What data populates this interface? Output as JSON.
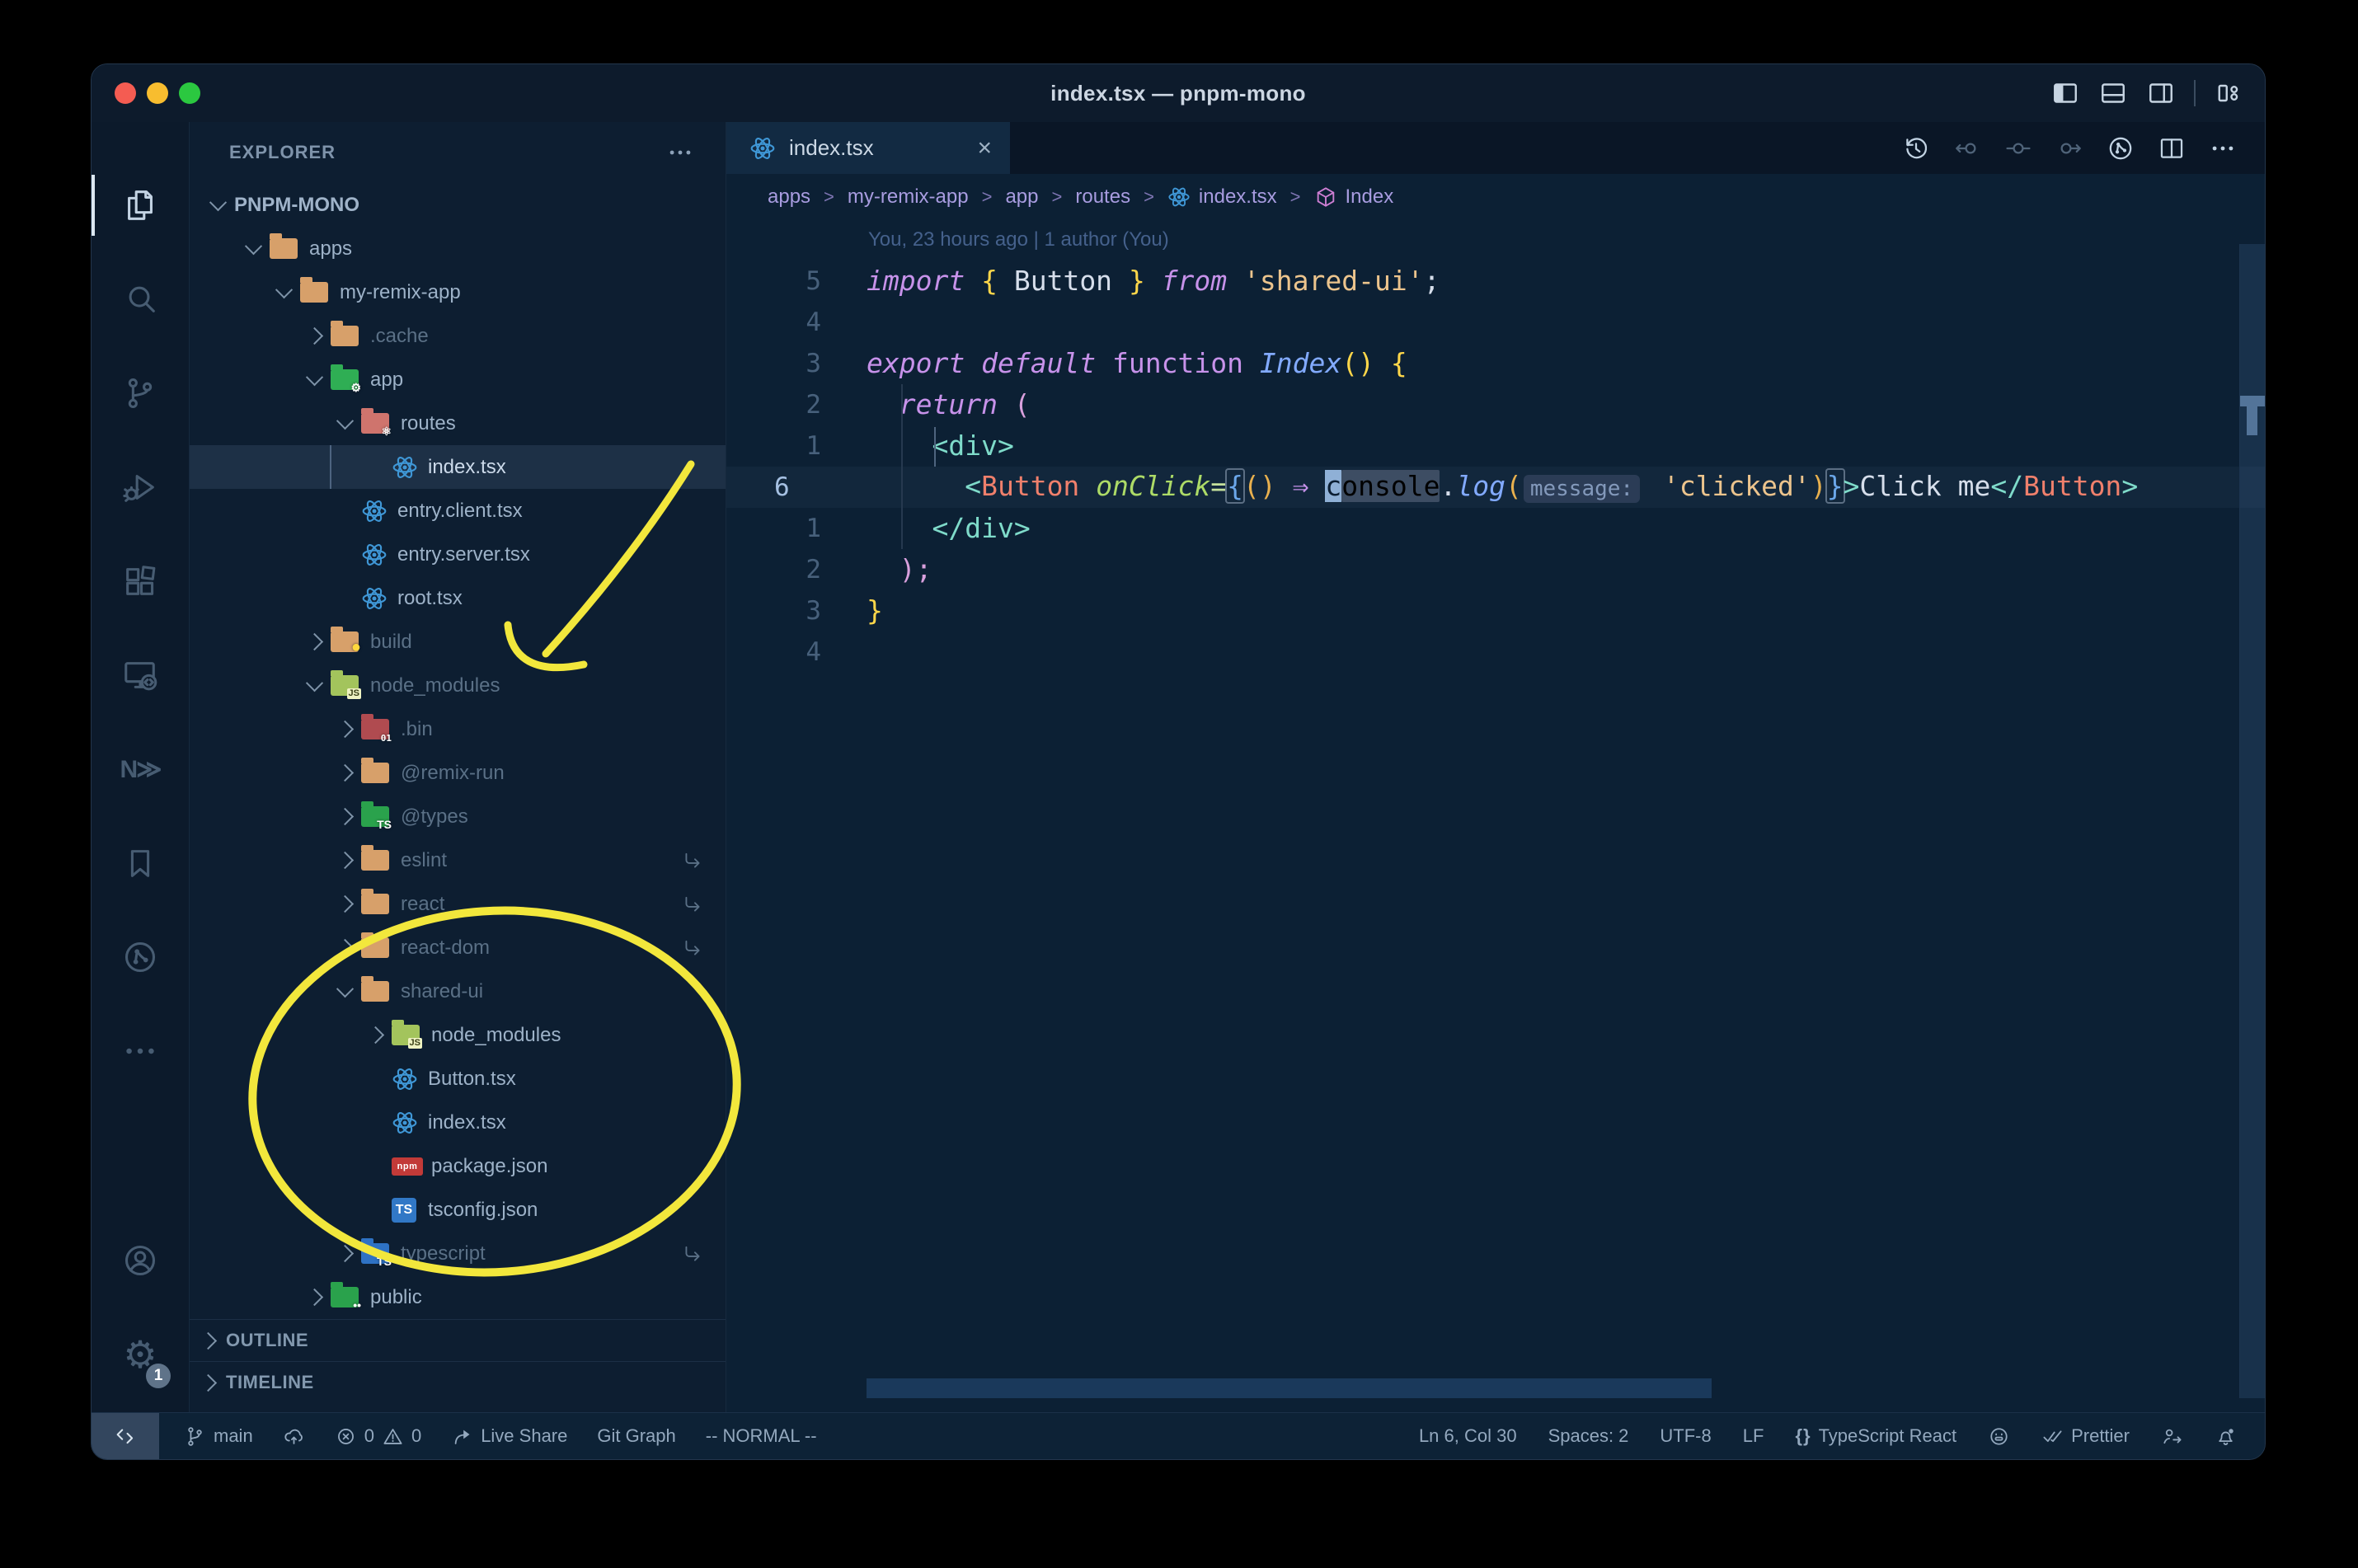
{
  "window": {
    "title": "index.tsx — pnpm-mono",
    "controls": [
      {
        "id": "toggle-primary-sidebar",
        "icon": "win-left"
      },
      {
        "id": "toggle-panel",
        "icon": "win-bottom"
      },
      {
        "id": "toggle-secondary-sidebar",
        "icon": "win-right"
      },
      {
        "id": "customize-layout",
        "icon": "layout"
      }
    ]
  },
  "activity_bar": {
    "items": [
      {
        "id": "explorer",
        "icon": "files",
        "active": true
      },
      {
        "id": "search",
        "icon": "search",
        "active": false
      },
      {
        "id": "source-control",
        "icon": "git",
        "active": false
      },
      {
        "id": "run-debug",
        "icon": "debug",
        "active": false
      },
      {
        "id": "extensions",
        "icon": "extensions",
        "active": false
      },
      {
        "id": "remote-explorer",
        "icon": "remote",
        "active": false
      },
      {
        "id": "nx-console",
        "icon": "nx",
        "text": "N≫",
        "active": false
      },
      {
        "id": "bookmarks",
        "icon": "bookmark",
        "active": false
      },
      {
        "id": "git-graph",
        "icon": "gitgraph",
        "active": false
      },
      {
        "id": "more-views",
        "icon": "more",
        "active": false
      }
    ],
    "bottom": [
      {
        "id": "accounts",
        "icon": "account"
      },
      {
        "id": "settings",
        "icon": "gear",
        "text": "⚙",
        "badge": "1"
      }
    ]
  },
  "explorer": {
    "title": "EXPLORER",
    "actions_icon": "more",
    "sections": [
      {
        "label": "OUTLINE"
      },
      {
        "label": "TIMELINE"
      }
    ]
  },
  "tree": [
    {
      "label": "PNPM-MONO",
      "kind": "root",
      "level": 0,
      "expanded": true
    },
    {
      "label": "apps",
      "icon": "folder",
      "kind": "folder",
      "level": 1,
      "expanded": true
    },
    {
      "label": "my-remix-app",
      "icon": "folder",
      "kind": "folder",
      "level": 2,
      "expanded": true
    },
    {
      "label": ".cache",
      "icon": "folder",
      "kind": "folder",
      "level": 3,
      "expanded": false,
      "dim": true
    },
    {
      "label": "app",
      "icon": "folder-app",
      "kind": "folder",
      "level": 3,
      "expanded": true
    },
    {
      "label": "routes",
      "icon": "folder-routes",
      "kind": "folder",
      "level": 4,
      "expanded": true
    },
    {
      "label": "index.tsx",
      "icon": "react",
      "kind": "file",
      "level": 5,
      "selected": true
    },
    {
      "label": "entry.client.tsx",
      "icon": "react",
      "kind": "file",
      "level": 4
    },
    {
      "label": "entry.server.tsx",
      "icon": "react",
      "kind": "file",
      "level": 4
    },
    {
      "label": "root.tsx",
      "icon": "react",
      "kind": "file",
      "level": 4
    },
    {
      "label": "build",
      "icon": "folder-build",
      "kind": "folder",
      "level": 3,
      "expanded": false,
      "dim": true
    },
    {
      "label": "node_modules",
      "icon": "folder-js",
      "kind": "folder",
      "level": 3,
      "expanded": true,
      "dim": true
    },
    {
      "label": ".bin",
      "icon": "folder-bin",
      "kind": "folder",
      "level": 4,
      "expanded": false,
      "dim": true
    },
    {
      "label": "@remix-run",
      "icon": "folder",
      "kind": "folder",
      "level": 4,
      "expanded": false,
      "dim": true
    },
    {
      "label": "@types",
      "icon": "folder-ts-green",
      "kind": "folder",
      "level": 4,
      "expanded": false,
      "dim": true
    },
    {
      "label": "eslint",
      "icon": "folder",
      "kind": "folder",
      "level": 4,
      "expanded": false,
      "dim": true,
      "symlink": true
    },
    {
      "label": "react",
      "icon": "folder",
      "kind": "folder",
      "level": 4,
      "expanded": false,
      "dim": true,
      "symlink": true
    },
    {
      "label": "react-dom",
      "icon": "folder",
      "kind": "folder",
      "level": 4,
      "expanded": false,
      "dim": true,
      "symlink": true
    },
    {
      "label": "shared-ui",
      "icon": "folder",
      "kind": "folder",
      "level": 4,
      "expanded": true,
      "dim": true
    },
    {
      "label": "node_modules",
      "icon": "folder-js",
      "kind": "folder",
      "level": 5,
      "expanded": false
    },
    {
      "label": "Button.tsx",
      "icon": "react",
      "kind": "file",
      "level": 5
    },
    {
      "label": "index.tsx",
      "icon": "react",
      "kind": "file",
      "level": 5
    },
    {
      "label": "package.json",
      "icon": "npm",
      "kind": "file",
      "level": 5
    },
    {
      "label": "tsconfig.json",
      "icon": "ts",
      "kind": "file",
      "level": 5
    },
    {
      "label": "typescript",
      "icon": "folder-ts-blue",
      "kind": "folder",
      "level": 4,
      "expanded": false,
      "dim": true,
      "symlink": true
    },
    {
      "label": "public",
      "icon": "folder-public",
      "kind": "folder",
      "level": 3,
      "expanded": false
    }
  ],
  "editor": {
    "tab": {
      "label": "index.tsx",
      "icon": "react",
      "close": "×"
    },
    "toolbar": [
      {
        "id": "timeline-history",
        "icon": "history",
        "bright": true
      },
      {
        "id": "previous-change",
        "icon": "prevchange",
        "bright": false
      },
      {
        "id": "current-change",
        "icon": "change",
        "bright": false
      },
      {
        "id": "next-change",
        "icon": "nextchange",
        "bright": false
      },
      {
        "id": "git-graph",
        "icon": "gitgraph",
        "bright": true
      },
      {
        "id": "split-editor",
        "icon": "split",
        "bright": true
      },
      {
        "id": "more-actions",
        "icon": "more",
        "bright": true
      }
    ],
    "breadcrumbs": [
      {
        "label": "apps"
      },
      {
        "label": "my-remix-app"
      },
      {
        "label": "app"
      },
      {
        "label": "routes"
      },
      {
        "label": "index.tsx",
        "icon": "react"
      },
      {
        "label": "Index",
        "icon": "cube"
      }
    ],
    "blame": "You, 23 hours ago | 1 author (You)",
    "lines": [
      {
        "num": "5",
        "tokens": [
          {
            "s": "kw",
            "t": "import"
          },
          {
            "s": "pl",
            "t": " "
          },
          {
            "s": "gold",
            "t": "{"
          },
          {
            "s": "pl",
            "t": " "
          },
          {
            "s": "var",
            "t": "Button"
          },
          {
            "s": "pl",
            "t": " "
          },
          {
            "s": "gold",
            "t": "}"
          },
          {
            "s": "pl",
            "t": " "
          },
          {
            "s": "kw",
            "t": "from"
          },
          {
            "s": "pl",
            "t": " "
          },
          {
            "s": "str",
            "t": "'shared-ui'"
          },
          {
            "s": "pl",
            "t": ";"
          }
        ]
      },
      {
        "num": "4",
        "tokens": []
      },
      {
        "num": "3",
        "tokens": [
          {
            "s": "kw",
            "t": "export"
          },
          {
            "s": "pl",
            "t": " "
          },
          {
            "s": "kw",
            "t": "default"
          },
          {
            "s": "pl",
            "t": " "
          },
          {
            "s": "kwu",
            "t": "function"
          },
          {
            "s": "pl",
            "t": " "
          },
          {
            "s": "fn",
            "t": "Index"
          },
          {
            "s": "gold",
            "t": "()"
          },
          {
            "s": "pl",
            "t": " "
          },
          {
            "s": "gold",
            "t": "{"
          }
        ]
      },
      {
        "num": "2",
        "tokens": [
          {
            "s": "pl",
            "t": "  "
          },
          {
            "s": "kw",
            "t": "return"
          },
          {
            "s": "pl",
            "t": " "
          },
          {
            "s": "orchid",
            "t": "("
          }
        ]
      },
      {
        "num": "1",
        "tokens": [
          {
            "s": "pl",
            "t": "    "
          },
          {
            "s": "teal",
            "t": "<div>"
          }
        ]
      },
      {
        "num": "6",
        "current": true,
        "tokens": [
          {
            "s": "pl",
            "t": "      "
          },
          {
            "s": "teal",
            "t": "<"
          },
          {
            "s": "comp",
            "t": "Button"
          },
          {
            "s": "pl",
            "t": " "
          },
          {
            "s": "attr",
            "t": "onClick"
          },
          {
            "s": "op",
            "t": "="
          },
          {
            "s": "blueb",
            "t": "{"
          },
          {
            "s": "goldo",
            "t": "()"
          },
          {
            "s": "pl",
            "t": " "
          },
          {
            "s": "arrow",
            "t": "⇒"
          },
          {
            "s": "pl",
            "t": " "
          },
          {
            "s": "cursor",
            "t": "c"
          },
          {
            "s": "hl",
            "t": "onsole"
          },
          {
            "s": "pl",
            "t": "."
          },
          {
            "s": "fn",
            "t": "log"
          },
          {
            "s": "goldo",
            "t": "("
          },
          {
            "s": "inlay",
            "t": "message:"
          },
          {
            "s": "pl",
            "t": " "
          },
          {
            "s": "str",
            "t": "'clicked'"
          },
          {
            "s": "goldo",
            "t": ")"
          },
          {
            "s": "blueb",
            "t": "}"
          },
          {
            "s": "teal",
            "t": ">"
          },
          {
            "s": "pl",
            "t": "Click me"
          },
          {
            "s": "teal",
            "t": "</"
          },
          {
            "s": "comp",
            "t": "Button"
          },
          {
            "s": "teal",
            "t": ">"
          }
        ]
      },
      {
        "num": "1",
        "tokens": [
          {
            "s": "pl",
            "t": "    "
          },
          {
            "s": "teal",
            "t": "</div>"
          }
        ]
      },
      {
        "num": "2",
        "tokens": [
          {
            "s": "pl",
            "t": "  "
          },
          {
            "s": "orchid",
            "t": ");"
          }
        ]
      },
      {
        "num": "3",
        "tokens": [
          {
            "s": "gold",
            "t": "}"
          }
        ]
      },
      {
        "num": "4",
        "tokens": []
      }
    ]
  },
  "status_bar": {
    "left": [
      {
        "name": "remote-indicator",
        "icon": "remoteind",
        "cls": "remote"
      },
      {
        "name": "git-branch",
        "icon": "branch",
        "label": "main"
      },
      {
        "name": "sync-changes",
        "icon": "cloudup"
      },
      {
        "name": "problems",
        "icon": "error",
        "label": "0",
        "icon2": "warn",
        "label2": "0"
      },
      {
        "name": "live-share",
        "icon": "share",
        "label": "Live Share"
      },
      {
        "name": "git-graph",
        "label": "Git Graph"
      },
      {
        "name": "vim-mode",
        "label": "-- NORMAL --"
      }
    ],
    "right": [
      {
        "name": "cursor-position",
        "label": "Ln 6, Col 30"
      },
      {
        "name": "indentation",
        "label": "Spaces: 2"
      },
      {
        "name": "encoding",
        "label": "UTF-8"
      },
      {
        "name": "eol",
        "label": "LF"
      },
      {
        "name": "language-mode",
        "icon": "braces",
        "label": "TypeScript React"
      },
      {
        "name": "feedback",
        "icon": "smiley"
      },
      {
        "name": "prettier",
        "icon": "check2",
        "label": "Prettier"
      },
      {
        "name": "live-share-contact",
        "icon": "personarrow"
      },
      {
        "name": "notifications",
        "icon": "bell"
      }
    ]
  },
  "annotations": {
    "color": "#f2e73c",
    "items": [
      {
        "type": "arrow",
        "points_to": "node_modules folder in explorer"
      },
      {
        "type": "ellipse",
        "around": "shared-ui package contents in explorer"
      }
    ]
  },
  "colors": {
    "editor_bg": "#0c2034",
    "sidebar_bg": "#0d1e31",
    "titlebar_bg": "#0d1b2c",
    "statusbar_bg": "#0d2236",
    "selection_row": "#1d3046",
    "keyword": "#c792ea",
    "string": "#ecc48d",
    "function": "#82aaff",
    "tag": "#7fdbca",
    "component": "#f0806c",
    "attribute": "#addb67",
    "annotation_yellow": "#f2e73c"
  }
}
